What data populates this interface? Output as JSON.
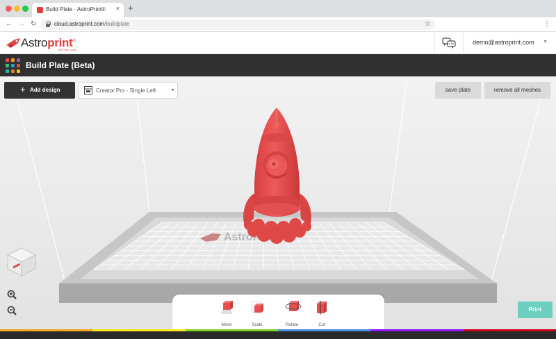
{
  "browser": {
    "tab_title": "Build Plate · AstroPrint®",
    "tab_close": "×",
    "new_tab": "+",
    "url_domain": "cloud.astroprint.com",
    "url_path": "/buildplate",
    "back": "←",
    "forward": "→",
    "reload": "↻",
    "star": "☆",
    "menu": "⋮"
  },
  "header": {
    "logo_prefix": "Astro",
    "logo_bold": "print",
    "logo_mark": "®",
    "logo_sub": "3D Print Cloud",
    "user_email": "demo@astroprint.com",
    "user_caret": "▼"
  },
  "titlebar": {
    "title": "Build Plate (Beta)",
    "grid_colors": [
      "#e84c3d",
      "#f39c12",
      "#9b59b6",
      "#2ecc71",
      "#3498db",
      "#e74c3c",
      "#1abc9c",
      "#e67e22",
      "#f1c40f"
    ]
  },
  "toolbar_top": {
    "add_design_icon": "+",
    "add_design_label": "Add design",
    "printer_selected": "Creator Pro - Single Left",
    "printer_caret": "▾",
    "save_plate_label": "save plate",
    "remove_meshes_label": "remove all meshes"
  },
  "scene": {
    "bed_logo_text": "AstroPrint",
    "model_color": "#e85050",
    "model_name": "rocket"
  },
  "tools": {
    "move": "Move",
    "scale": "Scale",
    "rotate": "Rotate",
    "cut": "Cut"
  },
  "print_label": "Print",
  "colors": {
    "brand_red": "#e2403e",
    "print_teal": "#6dcfbe",
    "titlebar_bg": "#303030",
    "model_red": "#e85050"
  },
  "rainbow": [
    "#f5a623",
    "#f8e71c",
    "#7ed321",
    "#4a90e2",
    "#9013fe",
    "#d0021b"
  ]
}
